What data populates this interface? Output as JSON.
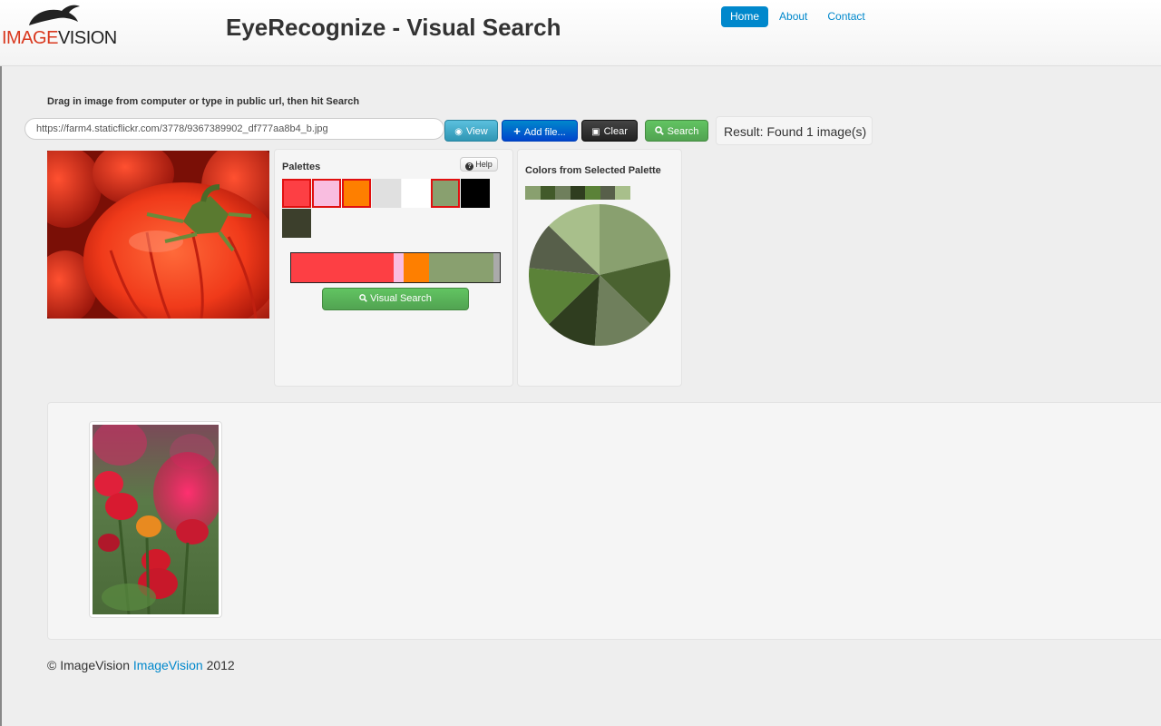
{
  "app": {
    "logo_part1": "IMAGE",
    "logo_part2": "VISION",
    "title": "EyeRecognize - Visual Search"
  },
  "nav": {
    "items": [
      {
        "label": "Home",
        "active": true
      },
      {
        "label": "About",
        "active": false
      },
      {
        "label": "Contact",
        "active": false
      }
    ]
  },
  "search": {
    "instruction": "Drag in image from computer or type in public url, then hit Search",
    "url_value": "https://farm4.staticflickr.com/3778/9367389902_df777aa8b4_b.jpg",
    "view_label": "View",
    "add_file_label": "Add file...",
    "clear_label": "Clear",
    "search_label": "Search",
    "result_text": "Result: Found 1 image(s)"
  },
  "palettes": {
    "title": "Palettes",
    "help_label": "Help",
    "swatches": [
      {
        "color": "#fd3f44",
        "selected": true
      },
      {
        "color": "#f9bde0",
        "selected": true
      },
      {
        "color": "#fe7f00",
        "selected": true
      },
      {
        "color": "#e0e0e0",
        "selected": false
      },
      {
        "color": "#ffffff",
        "selected": false
      },
      {
        "color": "#89a06f",
        "selected": true
      },
      {
        "color": "#000000",
        "selected": false
      },
      {
        "color": "#3c3f2c",
        "selected": false
      }
    ],
    "bar_segments": [
      {
        "color": "#fd3f44",
        "fraction": 0.49
      },
      {
        "color": "#f9bde0",
        "fraction": 0.05
      },
      {
        "color": "#fe7f00",
        "fraction": 0.12
      },
      {
        "color": "#89a06f",
        "fraction": 0.31
      },
      {
        "color": "#aaaaaa",
        "fraction": 0.03
      }
    ],
    "visual_search_label": "Visual Search"
  },
  "selected_palette": {
    "title": "Colors from Selected Palette",
    "colors": [
      "#89a06f",
      "#425a2a",
      "#6f7f5c",
      "#2f3d1f",
      "#5b8238",
      "#575f4a",
      "#a8bf8b"
    ]
  },
  "chart_data": {
    "type": "pie",
    "values": [
      20,
      15,
      13,
      11,
      13,
      10,
      12
    ],
    "colors": [
      "#89a06f",
      "#4a6230",
      "#6f7f5c",
      "#2f3d1f",
      "#5b8238",
      "#575f4a",
      "#a8bf8b"
    ]
  },
  "footer": {
    "prefix": "© ImageVision ",
    "link": "ImageVision",
    "suffix": " 2012"
  }
}
